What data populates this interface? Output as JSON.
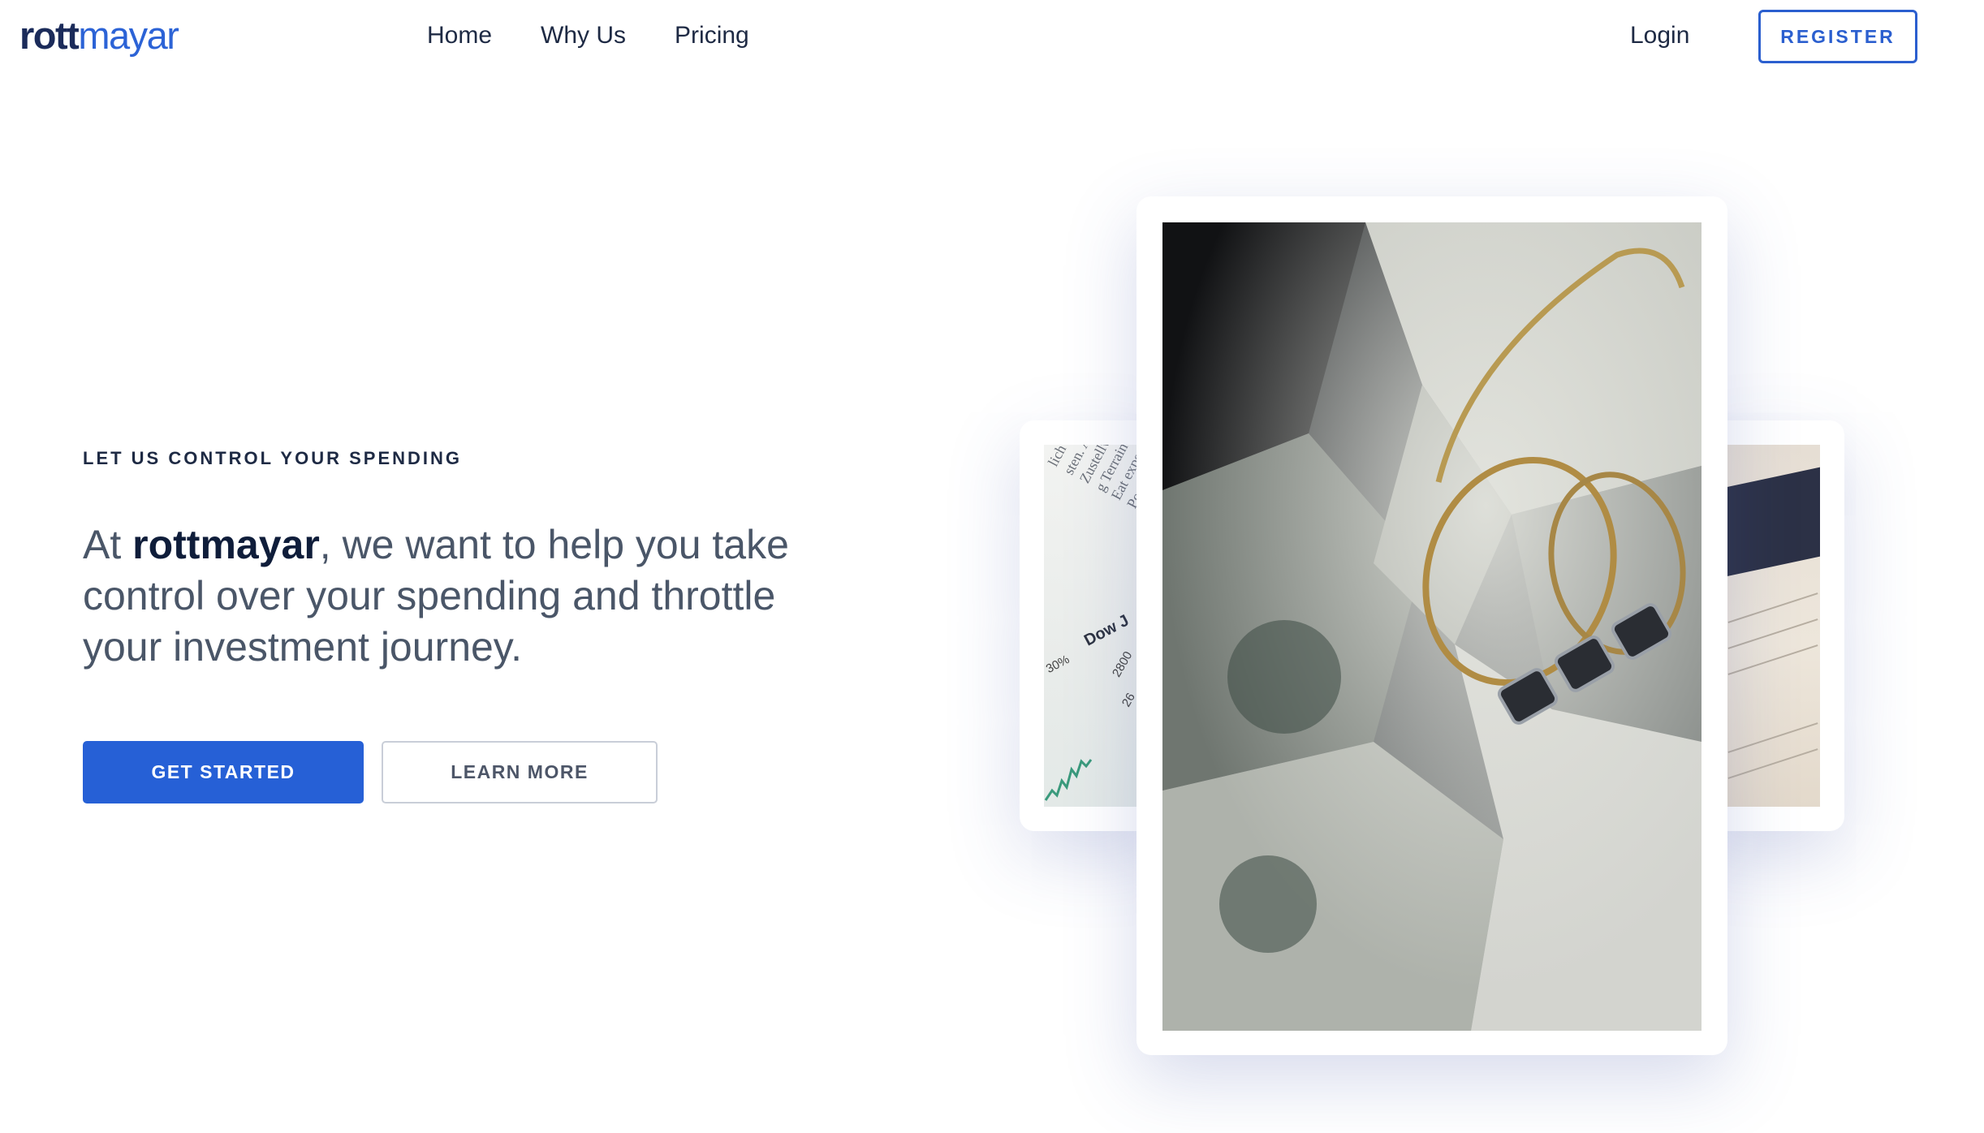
{
  "brand": {
    "logo_part1": "rott",
    "logo_part2": "mayar"
  },
  "nav": {
    "main": [
      {
        "label": "Home"
      },
      {
        "label": "Why Us"
      },
      {
        "label": "Pricing"
      }
    ],
    "login_label": "Login",
    "register_label": "REGISTER"
  },
  "hero": {
    "eyebrow": "LET US CONTROL YOUR SPENDING",
    "headline_prefix": "At ",
    "headline_brand": "rottmayar",
    "headline_suffix": ", we want to help you take control over your spending and throttle your investment journey.",
    "primary_button": "GET STARTED",
    "secondary_button": "LEARN MORE"
  },
  "images": {
    "left": {
      "lines": [
        "lich für",
        "sten. Auf diese",
        "Zustellwege v",
        "g Terrain gut",
        "Eat experim",
        "Pop-up-Küc",
        "Dow J",
        "30%",
        "2800",
        "26"
      ]
    },
    "main": "crumpled-dollar-bills-and-jewelry-photo",
    "right": "investment-document-photo"
  },
  "colors": {
    "brand_dark": "#1b2b5a",
    "brand_blue": "#2c63d6",
    "primary_button": "#2660d6",
    "text_body": "#4a5668"
  }
}
